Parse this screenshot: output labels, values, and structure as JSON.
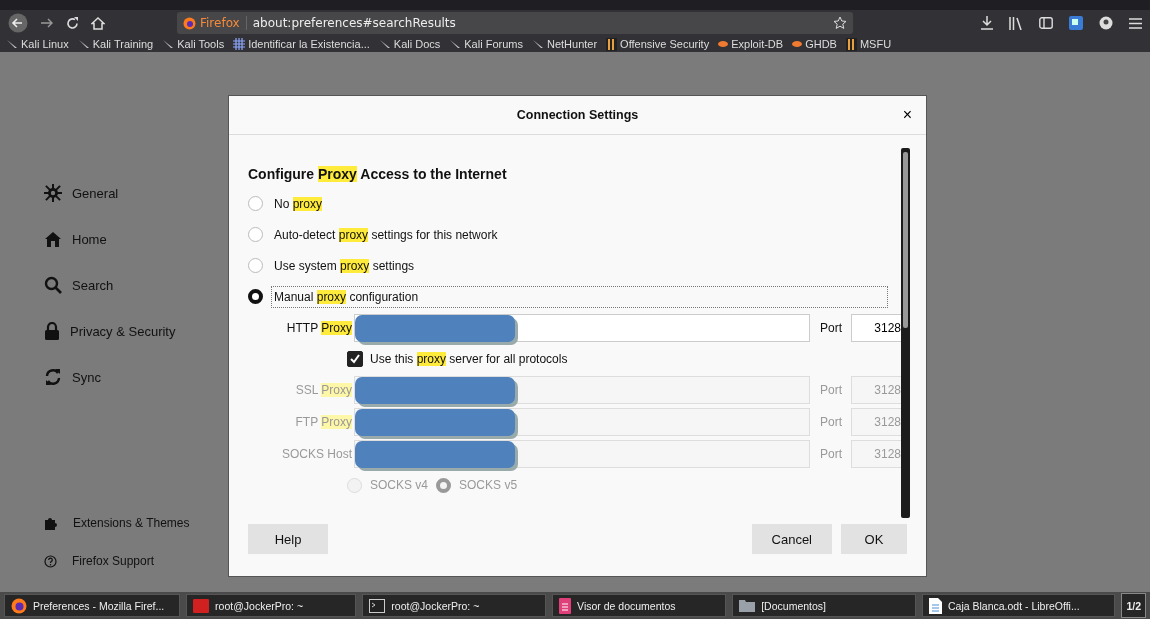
{
  "toolbar": {
    "identity": "Firefox",
    "url": "about:preferences#searchResults"
  },
  "bookmarks": [
    "Kali Linux",
    "Kali Training",
    "Kali Tools",
    "Identificar la Existencia...",
    "Kali Docs",
    "Kali Forums",
    "NetHunter",
    "Offensive Security",
    "Exploit-DB",
    "GHDB",
    "MSFU"
  ],
  "sidebar": {
    "items": [
      {
        "label": "General",
        "selected": false
      },
      {
        "label": "Home",
        "selected": false
      },
      {
        "label": "Search",
        "selected": false
      },
      {
        "label": "Privacy & Security",
        "selected": false
      },
      {
        "label": "Sync",
        "selected": false
      }
    ],
    "footer": [
      "Extensions & Themes",
      "Firefox Support"
    ]
  },
  "dialog": {
    "title": "Connection Settings",
    "close": "×",
    "heading": [
      {
        "text": "Configure "
      },
      {
        "text": "Proxy",
        "highlight": true
      },
      {
        "text": " Access to the Internet"
      }
    ],
    "modes": [
      {
        "parts": [
          {
            "text": "No "
          },
          {
            "text": "proxy",
            "highlight": true
          }
        ],
        "selected": false,
        "focused": false
      },
      {
        "parts": [
          {
            "text": "Auto-detect "
          },
          {
            "text": "proxy",
            "highlight": true
          },
          {
            "text": " settings for this network"
          }
        ],
        "selected": false,
        "focused": false
      },
      {
        "parts": [
          {
            "text": "Use system "
          },
          {
            "text": "proxy",
            "highlight": true
          },
          {
            "text": " settings"
          }
        ],
        "selected": false,
        "focused": false
      },
      {
        "parts": [
          {
            "text": "Manual "
          },
          {
            "text": "proxy",
            "highlight": true
          },
          {
            "text": " configuration"
          }
        ],
        "selected": true,
        "focused": true
      }
    ],
    "proxies": [
      {
        "parts": [
          {
            "text": "HTTP "
          },
          {
            "text": "Proxy",
            "highlight": true
          }
        ],
        "port_label": "Port",
        "port": "3128",
        "disabled": false
      },
      {
        "kind": "checkbox",
        "parts": [
          {
            "text": "Use this "
          },
          {
            "text": "proxy",
            "highlight": true
          },
          {
            "text": " server for all protocols"
          }
        ],
        "checked": true
      },
      {
        "parts": [
          {
            "text": "SSL "
          },
          {
            "text": "Proxy",
            "highlight": true
          }
        ],
        "port_label": "Port",
        "port": "3128",
        "disabled": true
      },
      {
        "parts": [
          {
            "text": "FTP "
          },
          {
            "text": "Proxy",
            "highlight": true
          }
        ],
        "port_label": "Port",
        "port": "3128",
        "disabled": true
      },
      {
        "parts": [
          {
            "text": "SOCKS Host"
          }
        ],
        "port_label": "Port",
        "port": "3128",
        "disabled": true
      }
    ],
    "socks": [
      {
        "label": "SOCKS v4",
        "selected": false,
        "disabled": true
      },
      {
        "label": "SOCKS v5",
        "selected": true,
        "disabled": true
      }
    ],
    "buttons": [
      {
        "label": "Help",
        "kind": "left"
      },
      {
        "label": "Cancel",
        "kind": "right"
      },
      {
        "label": "OK",
        "kind": "right"
      }
    ]
  },
  "taskbar": {
    "items": [
      "Preferences - Mozilla Firef...",
      "root@JockerPro: ~",
      "root@JockerPro: ~",
      "Visor de documentos",
      "[Documentos]",
      "Caja Blanca.odt - LibreOffi..."
    ],
    "pager": "1/2"
  }
}
